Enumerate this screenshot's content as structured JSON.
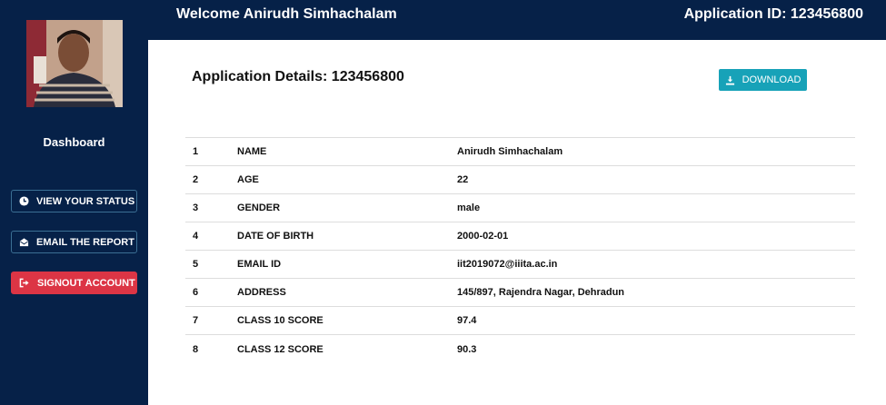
{
  "header": {
    "welcome": "Welcome Anirudh Simhachalam",
    "application_id": "Application ID: 123456800"
  },
  "sidebar": {
    "dashboard_label": "Dashboard",
    "buttons": [
      {
        "label": "VIEW YOUR STATUS",
        "icon": "clock-icon"
      },
      {
        "label": "EMAIL THE REPORT",
        "icon": "envelope-open-icon"
      },
      {
        "label": "SIGNOUT ACCOUNT",
        "icon": "sign-out-icon"
      }
    ]
  },
  "main": {
    "title": "Application Details: 123456800",
    "download_label": "DOWNLOAD",
    "rows": [
      {
        "num": "1",
        "field": "NAME",
        "value": "Anirudh Simhachalam"
      },
      {
        "num": "2",
        "field": "AGE",
        "value": "22"
      },
      {
        "num": "3",
        "field": "GENDER",
        "value": "male"
      },
      {
        "num": "4",
        "field": "DATE OF BIRTH",
        "value": "2000-02-01"
      },
      {
        "num": "5",
        "field": "EMAIL ID",
        "value": "iit2019072@iiita.ac.in"
      },
      {
        "num": "6",
        "field": "ADDRESS",
        "value": "145/897, Rajendra Nagar, Dehradun"
      },
      {
        "num": "7",
        "field": "CLASS 10 SCORE",
        "value": "97.4"
      },
      {
        "num": "8",
        "field": "CLASS 12 SCORE",
        "value": "90.3"
      }
    ]
  },
  "colors": {
    "navy": "#062148",
    "download": "#17a2b8",
    "signout": "#dc3545"
  }
}
